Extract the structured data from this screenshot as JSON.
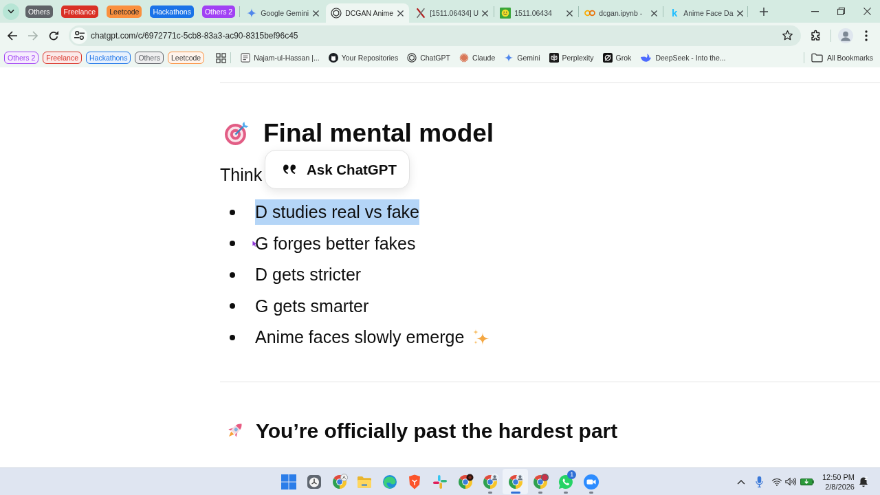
{
  "browser": {
    "tab_groups": [
      {
        "label": "Others",
        "color": "#5f6368"
      },
      {
        "label": "Freelance",
        "color": "#d93025"
      },
      {
        "label": "Leetcode",
        "color": "#fa903e"
      },
      {
        "label": "Hackathons",
        "color": "#1a73e8"
      },
      {
        "label": "Others 2",
        "color": "#a142f4"
      }
    ],
    "tabs": [
      {
        "title": "Google Gemini",
        "kind": "sparkle",
        "selected": false
      },
      {
        "title": "DCGAN Anime",
        "kind": "knot",
        "selected": true
      },
      {
        "title": "[1511.06434] U",
        "kind": "cross",
        "selected": false
      },
      {
        "title": "1511.06434",
        "kind": "smiley",
        "selected": false
      },
      {
        "title": "dcgan.ipynb -",
        "kind": "rings",
        "selected": false
      },
      {
        "title": "Anime Face Da",
        "kind": "letter",
        "glyph": "k",
        "selected": false
      }
    ],
    "navigation": {
      "can_go_back": true,
      "can_go_forward": false
    },
    "address_bar": {
      "url": "chatgpt.com/c/6972771c-5cb8-83a3-ac90-8315bef96c45",
      "bookmarked": false
    },
    "bookmark_groups": [
      {
        "label": "Others 2",
        "color": "#a142f4"
      },
      {
        "label": "Freelance",
        "color": "#d93025"
      },
      {
        "label": "Hackathons",
        "color": "#1a73e8"
      },
      {
        "label": "Others",
        "color": "#5f6368"
      },
      {
        "label": "Leetcode",
        "color": "#fa903e"
      }
    ],
    "bookmarks": [
      {
        "label": "Najam-ul-Hassan |...",
        "kind": "badge"
      },
      {
        "label": "Your Repositories",
        "kind": "cat"
      },
      {
        "label": "ChatGPT",
        "kind": "knot"
      },
      {
        "label": "Claude",
        "kind": "burst"
      },
      {
        "label": "Gemini",
        "kind": "sparkle"
      },
      {
        "label": "Perplexity",
        "kind": "grid"
      },
      {
        "label": "Grok",
        "kind": "ring"
      },
      {
        "label": "DeepSeek - Into the...",
        "kind": "whale"
      }
    ],
    "all_bookmarks": "All Bookmarks"
  },
  "content": {
    "heading": "Final mental model",
    "intro": "Think",
    "points": [
      {
        "text": "D studies real vs fake",
        "kind": "plain",
        "selected": true,
        "pointer": false
      },
      {
        "text": "G forges better fakes",
        "kind": "plain",
        "selected": false,
        "pointer": true
      },
      {
        "text": "D gets stricter",
        "kind": "plain",
        "selected": false,
        "pointer": false
      },
      {
        "text": "G gets smarter",
        "kind": "plain",
        "selected": false,
        "pointer": false
      },
      {
        "text": "Anime faces slowly emerge",
        "kind": "sparkle",
        "selected": false,
        "pointer": false
      }
    ],
    "next_heading": "You’re officially past the hardest part"
  },
  "popup": {
    "label": "Ask ChatGPT"
  },
  "taskbar": {
    "apps": [
      {
        "kind": "start",
        "running": false,
        "selected": false
      },
      {
        "kind": "clock",
        "running": false,
        "selected": false
      },
      {
        "kind": "browser-light",
        "running": false,
        "selected": false
      },
      {
        "kind": "folder",
        "running": false,
        "selected": false
      },
      {
        "kind": "swirl",
        "running": false,
        "selected": false
      },
      {
        "kind": "shield",
        "running": false,
        "selected": false
      },
      {
        "kind": "pinwheel",
        "running": false,
        "selected": false
      },
      {
        "kind": "browser-dark",
        "running": false,
        "selected": false
      },
      {
        "kind": "browser-avatar",
        "running": true,
        "selected": false
      },
      {
        "kind": "browser-avatar",
        "running": true,
        "selected": true
      },
      {
        "kind": "browser-red",
        "running": true,
        "selected": false
      },
      {
        "kind": "chat",
        "badge": "1",
        "running": true,
        "selected": false
      },
      {
        "kind": "video",
        "running": true,
        "selected": false
      }
    ],
    "tray": {
      "time": "12:50 PM",
      "date": "2/8/2026"
    }
  }
}
